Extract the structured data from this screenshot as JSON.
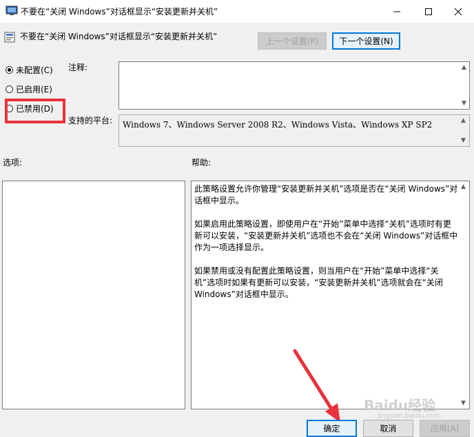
{
  "window": {
    "title": "不要在“关闭 Windows”对话框显示“安装更新并关机”"
  },
  "header": {
    "policy_title": "不要在“关闭 Windows”对话框显示“安装更新并关机”",
    "prev_label": "上一个设置(P)",
    "next_label": "下一个设置(N)"
  },
  "state": {
    "options": [
      {
        "label": "未配置(C)",
        "selected": true
      },
      {
        "label": "已启用(E)",
        "selected": false
      },
      {
        "label": "已禁用(D)",
        "selected": false
      }
    ]
  },
  "comment": {
    "label": "注释:",
    "value": ""
  },
  "platform": {
    "label": "支持的平台:",
    "value": "Windows 7、Windows Server 2008 R2、Windows Vista、Windows XP SP2"
  },
  "options_panel": {
    "label": "选项:"
  },
  "help_panel": {
    "label": "帮助:",
    "paragraphs": [
      "此策略设置允许你管理“安装更新并关机”选项是否在“关闭 Windows”对话框中显示。",
      "如果启用此策略设置，即使用户在“开始”菜单中选择“关机”选项时有更新可以安装，“安装更新并关机”选项也不会在“关闭 Windows”对话框中作为一项选择显示。",
      "如果禁用或没有配置此策略设置，则当用户在“开始”菜单中选择“关机”选项时如果有更新可以安装，“安装更新并关机”选项就会在“关闭 Windows”对话框中显示。"
    ]
  },
  "footer": {
    "ok_label": "确定",
    "cancel_label": "取消",
    "apply_label": "应用(A)"
  },
  "watermark": {
    "brand": "Baidu经验",
    "sub": "jingyan.baidu.com"
  },
  "colors": {
    "accent": "#0078d7",
    "annotation_red": "#e8323c"
  }
}
